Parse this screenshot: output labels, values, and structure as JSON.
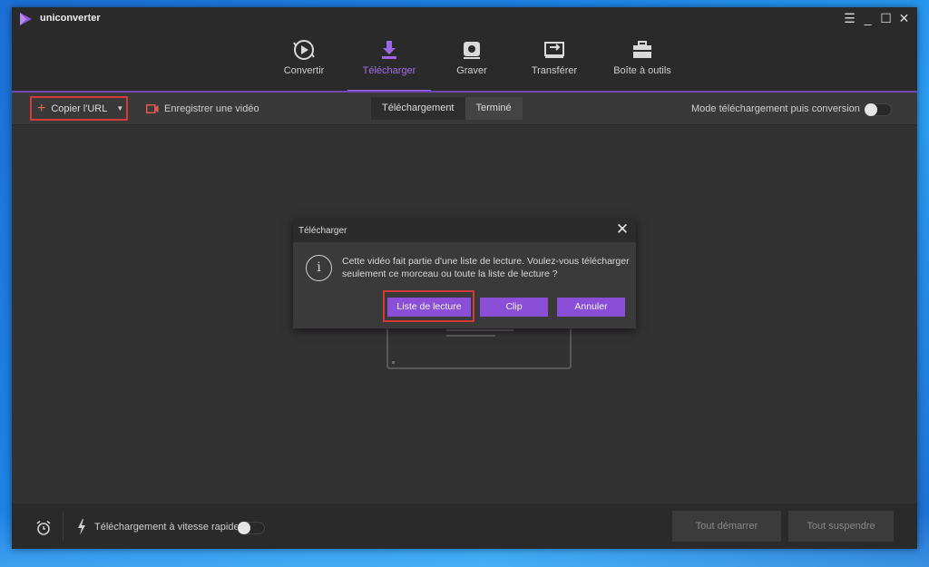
{
  "app": {
    "name": "uniconverter"
  },
  "window_controls": {
    "menu": "☰",
    "minimize": "_",
    "maximize": "☐",
    "close": "✕"
  },
  "nav": {
    "items": [
      {
        "label": "Convertir",
        "icon": "convert-icon"
      },
      {
        "label": "Télécharger",
        "icon": "download-icon",
        "active": true
      },
      {
        "label": "Graver",
        "icon": "burn-disc-icon"
      },
      {
        "label": "Transférer",
        "icon": "transfer-icon"
      },
      {
        "label": "Boîte à outils",
        "icon": "toolbox-icon"
      }
    ]
  },
  "toolbar": {
    "copy_url": "Copier l'URL",
    "record_video": "Enregistrer une vidéo",
    "tabs": [
      "Téléchargement",
      "Terminé"
    ],
    "mode_label": "Mode téléchargement puis conversion",
    "mode_enabled": false
  },
  "dialog": {
    "title": "Télécharger",
    "message": "Cette vidéo fait partie d'une liste de lecture. Voulez-vous télécharger seulement ce morceau ou toute la liste de lecture ?",
    "buttons": {
      "playlist": "Liste de lecture",
      "clip": "Clip",
      "cancel": "Annuler"
    }
  },
  "footer": {
    "fast_download_label": "Téléchargement à vitesse rapide",
    "fast_download_enabled": false,
    "start_all": "Tout démarrer",
    "pause_all": "Tout suspendre"
  },
  "colors": {
    "accent": "#9d66e6",
    "button": "#8a4fd6",
    "highlight": "#d33a3a",
    "background": "#333233"
  }
}
